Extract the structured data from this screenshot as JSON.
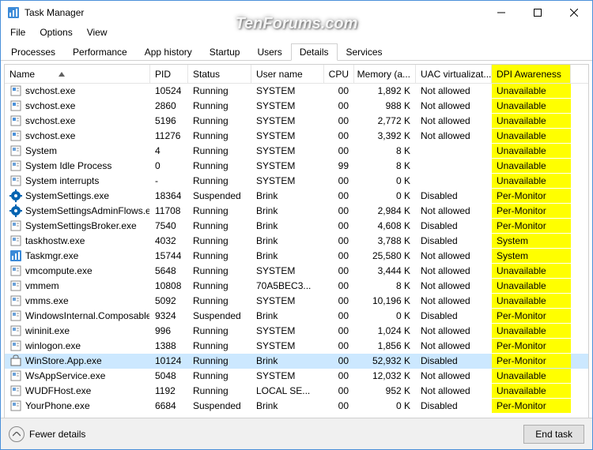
{
  "window": {
    "title": "Task Manager",
    "watermark": "TenForums.com"
  },
  "menubar": [
    "File",
    "Options",
    "View"
  ],
  "tabs": [
    "Processes",
    "Performance",
    "App history",
    "Startup",
    "Users",
    "Details",
    "Services"
  ],
  "active_tab": 5,
  "columns": [
    {
      "key": "name",
      "label": "Name"
    },
    {
      "key": "pid",
      "label": "PID"
    },
    {
      "key": "status",
      "label": "Status"
    },
    {
      "key": "user",
      "label": "User name"
    },
    {
      "key": "cpu",
      "label": "CPU"
    },
    {
      "key": "mem",
      "label": "Memory (a..."
    },
    {
      "key": "uac",
      "label": "UAC virtualizat..."
    },
    {
      "key": "dpi",
      "label": "DPI Awareness"
    }
  ],
  "processes": [
    {
      "name": "svchost.exe",
      "pid": "10524",
      "status": "Running",
      "user": "SYSTEM",
      "cpu": "00",
      "mem": "1,892 K",
      "uac": "Not allowed",
      "dpi": "Unavailable",
      "icon": "svc"
    },
    {
      "name": "svchost.exe",
      "pid": "2860",
      "status": "Running",
      "user": "SYSTEM",
      "cpu": "00",
      "mem": "988 K",
      "uac": "Not allowed",
      "dpi": "Unavailable",
      "icon": "svc"
    },
    {
      "name": "svchost.exe",
      "pid": "5196",
      "status": "Running",
      "user": "SYSTEM",
      "cpu": "00",
      "mem": "2,772 K",
      "uac": "Not allowed",
      "dpi": "Unavailable",
      "icon": "svc"
    },
    {
      "name": "svchost.exe",
      "pid": "11276",
      "status": "Running",
      "user": "SYSTEM",
      "cpu": "00",
      "mem": "3,392 K",
      "uac": "Not allowed",
      "dpi": "Unavailable",
      "icon": "svc"
    },
    {
      "name": "System",
      "pid": "4",
      "status": "Running",
      "user": "SYSTEM",
      "cpu": "00",
      "mem": "8 K",
      "uac": "",
      "dpi": "Unavailable",
      "icon": "gen"
    },
    {
      "name": "System Idle Process",
      "pid": "0",
      "status": "Running",
      "user": "SYSTEM",
      "cpu": "99",
      "mem": "8 K",
      "uac": "",
      "dpi": "Unavailable",
      "icon": "gen"
    },
    {
      "name": "System interrupts",
      "pid": "-",
      "status": "Running",
      "user": "SYSTEM",
      "cpu": "00",
      "mem": "0 K",
      "uac": "",
      "dpi": "Unavailable",
      "icon": "gen"
    },
    {
      "name": "SystemSettings.exe",
      "pid": "18364",
      "status": "Suspended",
      "user": "Brink",
      "cpu": "00",
      "mem": "0 K",
      "uac": "Disabled",
      "dpi": "Per-Monitor",
      "icon": "settings"
    },
    {
      "name": "SystemSettingsAdminFlows.exe",
      "pid": "11708",
      "status": "Running",
      "user": "Brink",
      "cpu": "00",
      "mem": "2,984 K",
      "uac": "Not allowed",
      "dpi": "Per-Monitor",
      "icon": "settings"
    },
    {
      "name": "SystemSettingsBroker.exe",
      "pid": "7540",
      "status": "Running",
      "user": "Brink",
      "cpu": "00",
      "mem": "4,608 K",
      "uac": "Disabled",
      "dpi": "Per-Monitor",
      "icon": "gen"
    },
    {
      "name": "taskhostw.exe",
      "pid": "4032",
      "status": "Running",
      "user": "Brink",
      "cpu": "00",
      "mem": "3,788 K",
      "uac": "Disabled",
      "dpi": "System",
      "icon": "gen"
    },
    {
      "name": "Taskmgr.exe",
      "pid": "15744",
      "status": "Running",
      "user": "Brink",
      "cpu": "00",
      "mem": "25,580 K",
      "uac": "Not allowed",
      "dpi": "System",
      "icon": "tm"
    },
    {
      "name": "vmcompute.exe",
      "pid": "5648",
      "status": "Running",
      "user": "SYSTEM",
      "cpu": "00",
      "mem": "3,444 K",
      "uac": "Not allowed",
      "dpi": "Unavailable",
      "icon": "gen"
    },
    {
      "name": "vmmem",
      "pid": "10808",
      "status": "Running",
      "user": "70A5BEC3...",
      "cpu": "00",
      "mem": "8 K",
      "uac": "Not allowed",
      "dpi": "Unavailable",
      "icon": "gen"
    },
    {
      "name": "vmms.exe",
      "pid": "5092",
      "status": "Running",
      "user": "SYSTEM",
      "cpu": "00",
      "mem": "10,196 K",
      "uac": "Not allowed",
      "dpi": "Unavailable",
      "icon": "gen"
    },
    {
      "name": "WindowsInternal.Composable...",
      "pid": "9324",
      "status": "Suspended",
      "user": "Brink",
      "cpu": "00",
      "mem": "0 K",
      "uac": "Disabled",
      "dpi": "Per-Monitor",
      "icon": "gen"
    },
    {
      "name": "wininit.exe",
      "pid": "996",
      "status": "Running",
      "user": "SYSTEM",
      "cpu": "00",
      "mem": "1,024 K",
      "uac": "Not allowed",
      "dpi": "Unavailable",
      "icon": "gen"
    },
    {
      "name": "winlogon.exe",
      "pid": "1388",
      "status": "Running",
      "user": "SYSTEM",
      "cpu": "00",
      "mem": "1,856 K",
      "uac": "Not allowed",
      "dpi": "Per-Monitor",
      "icon": "gen"
    },
    {
      "name": "WinStore.App.exe",
      "pid": "10124",
      "status": "Running",
      "user": "Brink",
      "cpu": "00",
      "mem": "52,932 K",
      "uac": "Disabled",
      "dpi": "Per-Monitor",
      "icon": "store",
      "selected": true
    },
    {
      "name": "WsAppService.exe",
      "pid": "5048",
      "status": "Running",
      "user": "SYSTEM",
      "cpu": "00",
      "mem": "12,032 K",
      "uac": "Not allowed",
      "dpi": "Unavailable",
      "icon": "gen"
    },
    {
      "name": "WUDFHost.exe",
      "pid": "1192",
      "status": "Running",
      "user": "LOCAL SE...",
      "cpu": "00",
      "mem": "952 K",
      "uac": "Not allowed",
      "dpi": "Unavailable",
      "icon": "gen"
    },
    {
      "name": "YourPhone.exe",
      "pid": "6684",
      "status": "Suspended",
      "user": "Brink",
      "cpu": "00",
      "mem": "0 K",
      "uac": "Disabled",
      "dpi": "Per-Monitor",
      "icon": "gen"
    }
  ],
  "footer": {
    "fewer": "Fewer details",
    "endtask": "End task"
  },
  "icons": {
    "svc": "#4a90d9",
    "gen": "#6aa0d8",
    "settings": "#0063b1",
    "tm": "#3b8ad8",
    "store": "#4a4a4a"
  }
}
